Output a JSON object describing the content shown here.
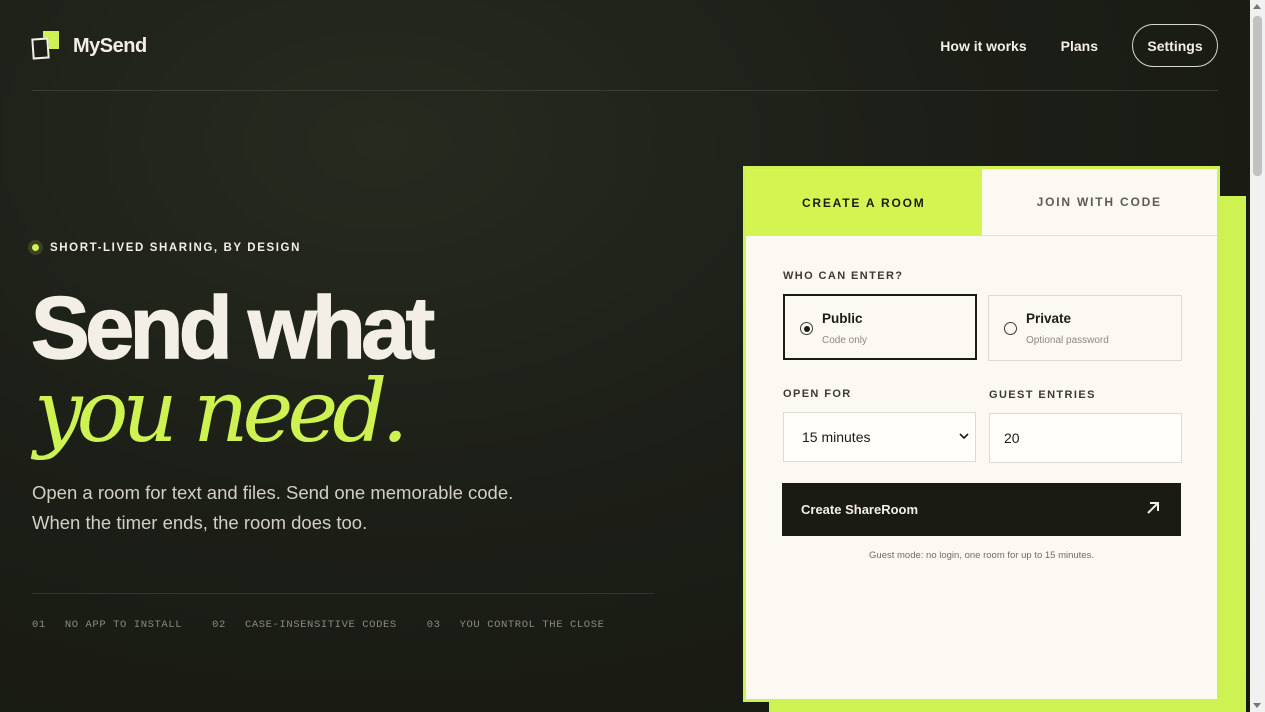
{
  "header": {
    "brand": "MySend",
    "nav": [
      "How it works",
      "Plans"
    ],
    "settings_label": "Settings"
  },
  "hero": {
    "tagline": "SHORT-LIVED SHARING, BY DESIGN",
    "headline_line1": "Send what",
    "headline_line2": "you need.",
    "sub_line1": "Open a room for text and files. Send one memorable code.",
    "sub_line2": "When the timer ends, the room does too.",
    "features": [
      {
        "num": "01",
        "label": "NO APP TO INSTALL"
      },
      {
        "num": "02",
        "label": "CASE-INSENSITIVE CODES"
      },
      {
        "num": "03",
        "label": "YOU CONTROL THE CLOSE"
      }
    ]
  },
  "card": {
    "tabs": [
      "CREATE A ROOM",
      "JOIN WITH CODE"
    ],
    "who_label": "WHO CAN ENTER?",
    "options": [
      {
        "title": "Public",
        "sub": "Code only",
        "selected": true
      },
      {
        "title": "Private",
        "sub": "Optional password",
        "selected": false
      }
    ],
    "open_label": "OPEN FOR",
    "open_value": "15 minutes",
    "guest_label": "GUEST ENTRIES",
    "guest_value": "20",
    "create_label": "Create ShareRoom",
    "note": "Guest mode: no login, one room for up to 15 minutes."
  },
  "colors": {
    "accent": "#cdf252",
    "background": "#1c1f17",
    "card": "#fbf9f2",
    "button": "#1a1c14"
  }
}
